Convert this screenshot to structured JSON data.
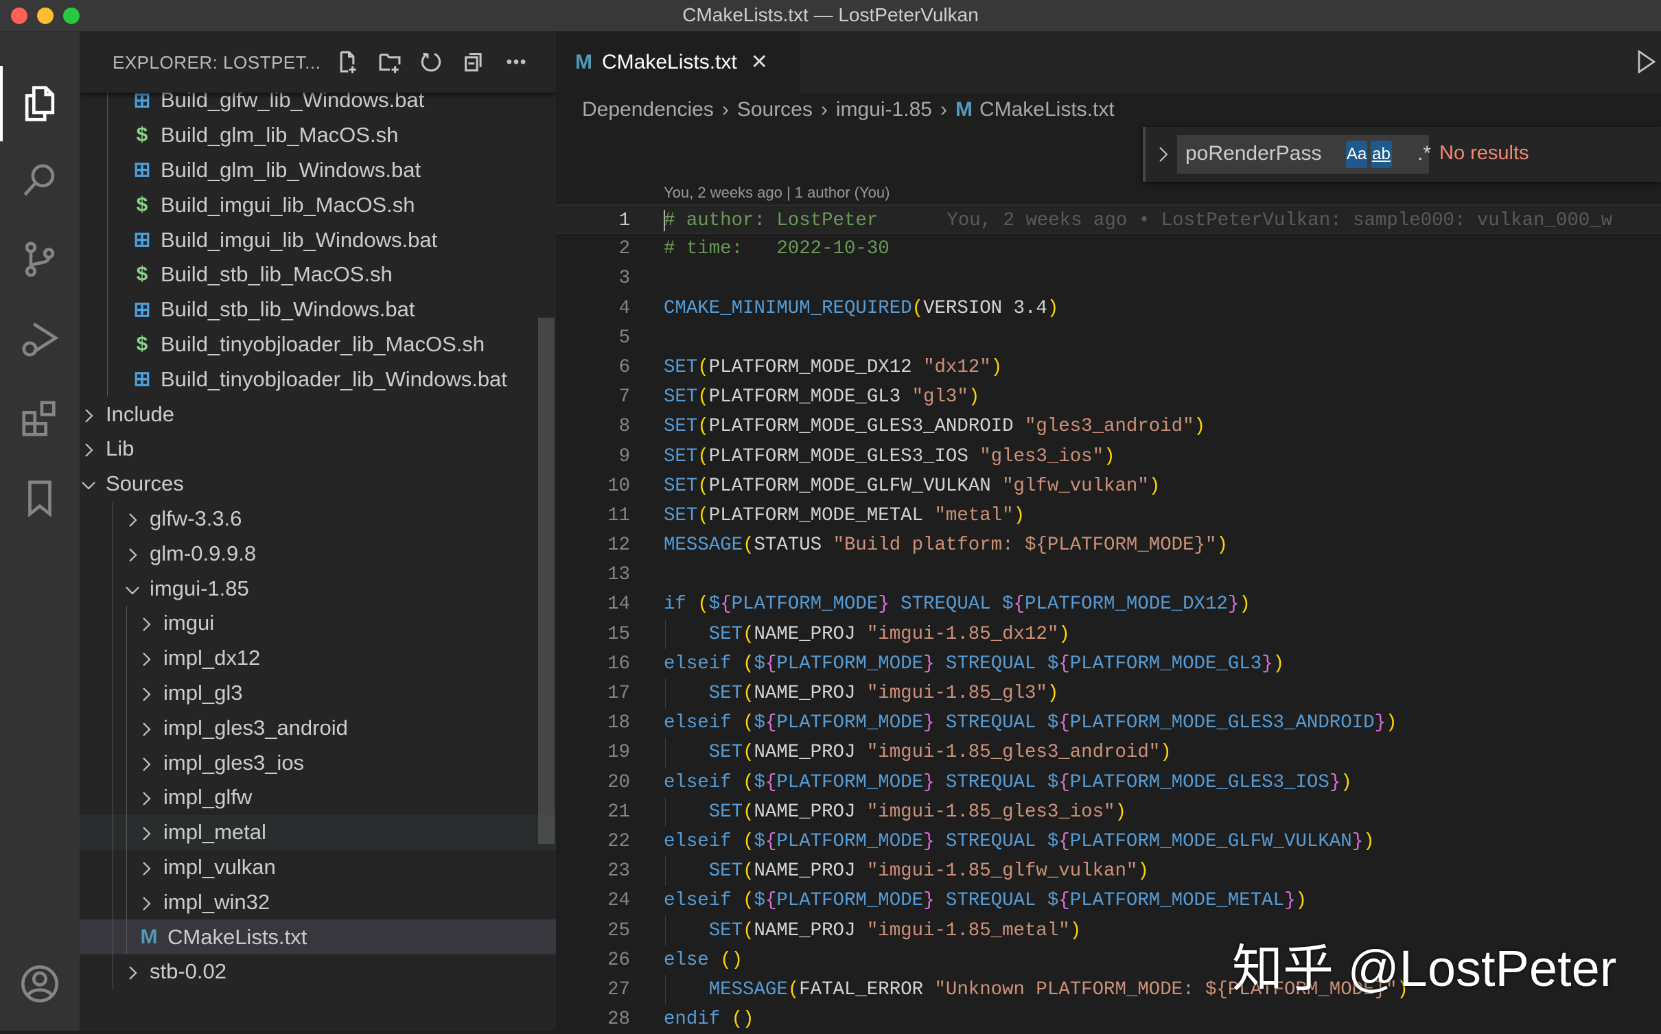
{
  "window": {
    "title": "CMakeLists.txt — LostPeterVulkan",
    "lights": [
      "#ff5f57",
      "#febc2e",
      "#28c840"
    ]
  },
  "activity_bar": {
    "items": [
      "explorer-icon",
      "search-icon",
      "source-control-icon",
      "run-debug-icon",
      "extensions-icon",
      "bookmarks-icon"
    ],
    "account": "account-icon"
  },
  "sidebar": {
    "title": "EXPLORER: LOSTPET...",
    "actions": [
      "new-file-icon",
      "new-folder-icon",
      "refresh-icon",
      "collapse-all-icon",
      "more-icon"
    ],
    "tree": [
      {
        "label": "Build_glfw_lib_Windows.bat",
        "type": "win",
        "depth": 1
      },
      {
        "label": "Build_glm_lib_MacOS.sh",
        "type": "sh",
        "depth": 1
      },
      {
        "label": "Build_glm_lib_Windows.bat",
        "type": "win",
        "depth": 1
      },
      {
        "label": "Build_imgui_lib_MacOS.sh",
        "type": "sh",
        "depth": 1
      },
      {
        "label": "Build_imgui_lib_Windows.bat",
        "type": "win",
        "depth": 1
      },
      {
        "label": "Build_stb_lib_MacOS.sh",
        "type": "sh",
        "depth": 1
      },
      {
        "label": "Build_stb_lib_Windows.bat",
        "type": "win",
        "depth": 1
      },
      {
        "label": "Build_tinyobjloader_lib_MacOS.sh",
        "type": "sh",
        "depth": 1
      },
      {
        "label": "Build_tinyobjloader_lib_Windows.bat",
        "type": "win",
        "depth": 1
      },
      {
        "label": "Include",
        "type": "closed",
        "depth": 0
      },
      {
        "label": "Lib",
        "type": "closed",
        "depth": 0
      },
      {
        "label": "Sources",
        "type": "open",
        "depth": 0
      },
      {
        "label": "glfw-3.3.6",
        "type": "closed",
        "depth": 1
      },
      {
        "label": "glm-0.9.9.8",
        "type": "closed",
        "depth": 1
      },
      {
        "label": "imgui-1.85",
        "type": "open",
        "depth": 1
      },
      {
        "label": "imgui",
        "type": "closed",
        "depth": 2
      },
      {
        "label": "impl_dx12",
        "type": "closed",
        "depth": 2
      },
      {
        "label": "impl_gl3",
        "type": "closed",
        "depth": 2
      },
      {
        "label": "impl_gles3_android",
        "type": "closed",
        "depth": 2
      },
      {
        "label": "impl_gles3_ios",
        "type": "closed",
        "depth": 2
      },
      {
        "label": "impl_glfw",
        "type": "closed",
        "depth": 2
      },
      {
        "label": "impl_metal",
        "type": "closed",
        "depth": 2,
        "state": "hover"
      },
      {
        "label": "impl_vulkan",
        "type": "closed",
        "depth": 2
      },
      {
        "label": "impl_win32",
        "type": "closed",
        "depth": 2
      },
      {
        "label": "CMakeLists.txt",
        "type": "cmake",
        "depth": 2,
        "state": "selected"
      },
      {
        "label": "stb-0.02",
        "type": "closed",
        "depth": 1
      }
    ],
    "file_icons": {
      "win": {
        "glyph": "⊞",
        "color": "#4aa3df"
      },
      "sh": {
        "glyph": "$",
        "color": "#89d185"
      },
      "cmake": {
        "glyph": "M",
        "color": "#519aba"
      }
    }
  },
  "editor": {
    "tab": {
      "label": "CMakeLists.txt",
      "icon": "M",
      "close": "✕"
    },
    "breadcrumb": [
      "Dependencies",
      "Sources",
      "imgui-1.85",
      "CMakeLists.txt"
    ],
    "find": {
      "value": "poRenderPass",
      "match_case": "Aa",
      "whole_word": "ab",
      "regex": ".*",
      "status": "No results"
    },
    "codelens": "You, 2 weeks ago | 1 author (You)",
    "blame": "You, 2 weeks ago • LostPeterVulkan: sample000: vulkan_000_w",
    "current_line": 1,
    "lines": [
      {
        "n": "1",
        "tokens": [
          [
            "cm",
            "# author: LostPeter"
          ]
        ]
      },
      {
        "n": "2",
        "tokens": [
          [
            "cm",
            "# time:   2022-10-30"
          ]
        ]
      },
      {
        "n": "3",
        "tokens": []
      },
      {
        "n": "4",
        "tokens": [
          [
            "kw",
            "CMAKE_MINIMUM_REQUIRED"
          ],
          [
            "br",
            "("
          ],
          [
            "tx",
            "VERSION 3.4"
          ],
          [
            "br",
            ")"
          ]
        ]
      },
      {
        "n": "5",
        "tokens": []
      },
      {
        "n": "6",
        "tokens": [
          [
            "kw",
            "SET"
          ],
          [
            "br",
            "("
          ],
          [
            "tx",
            "PLATFORM_MODE_DX12 "
          ],
          [
            "str",
            "\"dx12\""
          ],
          [
            "br",
            ")"
          ]
        ]
      },
      {
        "n": "7",
        "tokens": [
          [
            "kw",
            "SET"
          ],
          [
            "br",
            "("
          ],
          [
            "tx",
            "PLATFORM_MODE_GL3 "
          ],
          [
            "str",
            "\"gl3\""
          ],
          [
            "br",
            ")"
          ]
        ]
      },
      {
        "n": "8",
        "tokens": [
          [
            "kw",
            "SET"
          ],
          [
            "br",
            "("
          ],
          [
            "tx",
            "PLATFORM_MODE_GLES3_ANDROID "
          ],
          [
            "str",
            "\"gles3_android\""
          ],
          [
            "br",
            ")"
          ]
        ]
      },
      {
        "n": "9",
        "tokens": [
          [
            "kw",
            "SET"
          ],
          [
            "br",
            "("
          ],
          [
            "tx",
            "PLATFORM_MODE_GLES3_IOS "
          ],
          [
            "str",
            "\"gles3_ios\""
          ],
          [
            "br",
            ")"
          ]
        ]
      },
      {
        "n": "10",
        "tokens": [
          [
            "kw",
            "SET"
          ],
          [
            "br",
            "("
          ],
          [
            "tx",
            "PLATFORM_MODE_GLFW_VULKAN "
          ],
          [
            "str",
            "\"glfw_vulkan\""
          ],
          [
            "br",
            ")"
          ]
        ]
      },
      {
        "n": "11",
        "tokens": [
          [
            "kw",
            "SET"
          ],
          [
            "br",
            "("
          ],
          [
            "tx",
            "PLATFORM_MODE_METAL "
          ],
          [
            "str",
            "\"metal\""
          ],
          [
            "br",
            ")"
          ]
        ]
      },
      {
        "n": "12",
        "tokens": [
          [
            "kw",
            "MESSAGE"
          ],
          [
            "br",
            "("
          ],
          [
            "tx",
            "STATUS "
          ],
          [
            "str",
            "\"Build platform: ${PLATFORM_MODE}\""
          ],
          [
            "br",
            ")"
          ]
        ]
      },
      {
        "n": "13",
        "tokens": []
      },
      {
        "n": "14",
        "tokens": [
          [
            "kw",
            "if "
          ],
          [
            "br",
            "("
          ],
          [
            "kw",
            "$"
          ],
          [
            "cb",
            "{"
          ],
          [
            "kw",
            "PLATFORM_MODE"
          ],
          [
            "cb",
            "}"
          ],
          [
            "kw",
            " STREQUAL $"
          ],
          [
            "cb",
            "{"
          ],
          [
            "kw",
            "PLATFORM_MODE_DX12"
          ],
          [
            "cb",
            "}"
          ],
          [
            "br",
            ")"
          ]
        ]
      },
      {
        "n": "15",
        "indent": true,
        "tokens": [
          [
            "kw",
            "SET"
          ],
          [
            "br",
            "("
          ],
          [
            "tx",
            "NAME_PROJ "
          ],
          [
            "str",
            "\"imgui-1.85_dx12\""
          ],
          [
            "br",
            ")"
          ]
        ]
      },
      {
        "n": "16",
        "tokens": [
          [
            "kw",
            "elseif "
          ],
          [
            "br",
            "("
          ],
          [
            "kw",
            "$"
          ],
          [
            "cb",
            "{"
          ],
          [
            "kw",
            "PLATFORM_MODE"
          ],
          [
            "cb",
            "}"
          ],
          [
            "kw",
            " STREQUAL $"
          ],
          [
            "cb",
            "{"
          ],
          [
            "kw",
            "PLATFORM_MODE_GL3"
          ],
          [
            "cb",
            "}"
          ],
          [
            "br",
            ")"
          ]
        ]
      },
      {
        "n": "17",
        "indent": true,
        "tokens": [
          [
            "kw",
            "SET"
          ],
          [
            "br",
            "("
          ],
          [
            "tx",
            "NAME_PROJ "
          ],
          [
            "str",
            "\"imgui-1.85_gl3\""
          ],
          [
            "br",
            ")"
          ]
        ]
      },
      {
        "n": "18",
        "tokens": [
          [
            "kw",
            "elseif "
          ],
          [
            "br",
            "("
          ],
          [
            "kw",
            "$"
          ],
          [
            "cb",
            "{"
          ],
          [
            "kw",
            "PLATFORM_MODE"
          ],
          [
            "cb",
            "}"
          ],
          [
            "kw",
            " STREQUAL $"
          ],
          [
            "cb",
            "{"
          ],
          [
            "kw",
            "PLATFORM_MODE_GLES3_ANDROID"
          ],
          [
            "cb",
            "}"
          ],
          [
            "br",
            ")"
          ]
        ]
      },
      {
        "n": "19",
        "indent": true,
        "tokens": [
          [
            "kw",
            "SET"
          ],
          [
            "br",
            "("
          ],
          [
            "tx",
            "NAME_PROJ "
          ],
          [
            "str",
            "\"imgui-1.85_gles3_android\""
          ],
          [
            "br",
            ")"
          ]
        ]
      },
      {
        "n": "20",
        "tokens": [
          [
            "kw",
            "elseif "
          ],
          [
            "br",
            "("
          ],
          [
            "kw",
            "$"
          ],
          [
            "cb",
            "{"
          ],
          [
            "kw",
            "PLATFORM_MODE"
          ],
          [
            "cb",
            "}"
          ],
          [
            "kw",
            " STREQUAL $"
          ],
          [
            "cb",
            "{"
          ],
          [
            "kw",
            "PLATFORM_MODE_GLES3_IOS"
          ],
          [
            "cb",
            "}"
          ],
          [
            "br",
            ")"
          ]
        ]
      },
      {
        "n": "21",
        "indent": true,
        "tokens": [
          [
            "kw",
            "SET"
          ],
          [
            "br",
            "("
          ],
          [
            "tx",
            "NAME_PROJ "
          ],
          [
            "str",
            "\"imgui-1.85_gles3_ios\""
          ],
          [
            "br",
            ")"
          ]
        ]
      },
      {
        "n": "22",
        "tokens": [
          [
            "kw",
            "elseif "
          ],
          [
            "br",
            "("
          ],
          [
            "kw",
            "$"
          ],
          [
            "cb",
            "{"
          ],
          [
            "kw",
            "PLATFORM_MODE"
          ],
          [
            "cb",
            "}"
          ],
          [
            "kw",
            " STREQUAL $"
          ],
          [
            "cb",
            "{"
          ],
          [
            "kw",
            "PLATFORM_MODE_GLFW_VULKAN"
          ],
          [
            "cb",
            "}"
          ],
          [
            "br",
            ")"
          ]
        ]
      },
      {
        "n": "23",
        "indent": true,
        "tokens": [
          [
            "kw",
            "SET"
          ],
          [
            "br",
            "("
          ],
          [
            "tx",
            "NAME_PROJ "
          ],
          [
            "str",
            "\"imgui-1.85_glfw_vulkan\""
          ],
          [
            "br",
            ")"
          ]
        ]
      },
      {
        "n": "24",
        "tokens": [
          [
            "kw",
            "elseif "
          ],
          [
            "br",
            "("
          ],
          [
            "kw",
            "$"
          ],
          [
            "cb",
            "{"
          ],
          [
            "kw",
            "PLATFORM_MODE"
          ],
          [
            "cb",
            "}"
          ],
          [
            "kw",
            " STREQUAL $"
          ],
          [
            "cb",
            "{"
          ],
          [
            "kw",
            "PLATFORM_MODE_METAL"
          ],
          [
            "cb",
            "}"
          ],
          [
            "br",
            ")"
          ]
        ]
      },
      {
        "n": "25",
        "indent": true,
        "tokens": [
          [
            "kw",
            "SET"
          ],
          [
            "br",
            "("
          ],
          [
            "tx",
            "NAME_PROJ "
          ],
          [
            "str",
            "\"imgui-1.85_metal\""
          ],
          [
            "br",
            ")"
          ]
        ]
      },
      {
        "n": "26",
        "tokens": [
          [
            "kw",
            "else "
          ],
          [
            "br",
            "()"
          ]
        ]
      },
      {
        "n": "27",
        "indent": true,
        "tokens": [
          [
            "kw",
            "MESSAGE"
          ],
          [
            "br",
            "("
          ],
          [
            "tx",
            "FATAL_ERROR "
          ],
          [
            "str",
            "\"Unknown PLATFORM_MODE: ${PLATFORM_MODE}\""
          ],
          [
            "br",
            ")"
          ]
        ]
      },
      {
        "n": "28",
        "tokens": [
          [
            "kw",
            "endif "
          ],
          [
            "br",
            "()"
          ]
        ]
      }
    ]
  },
  "watermark": "知乎 @LostPeter"
}
